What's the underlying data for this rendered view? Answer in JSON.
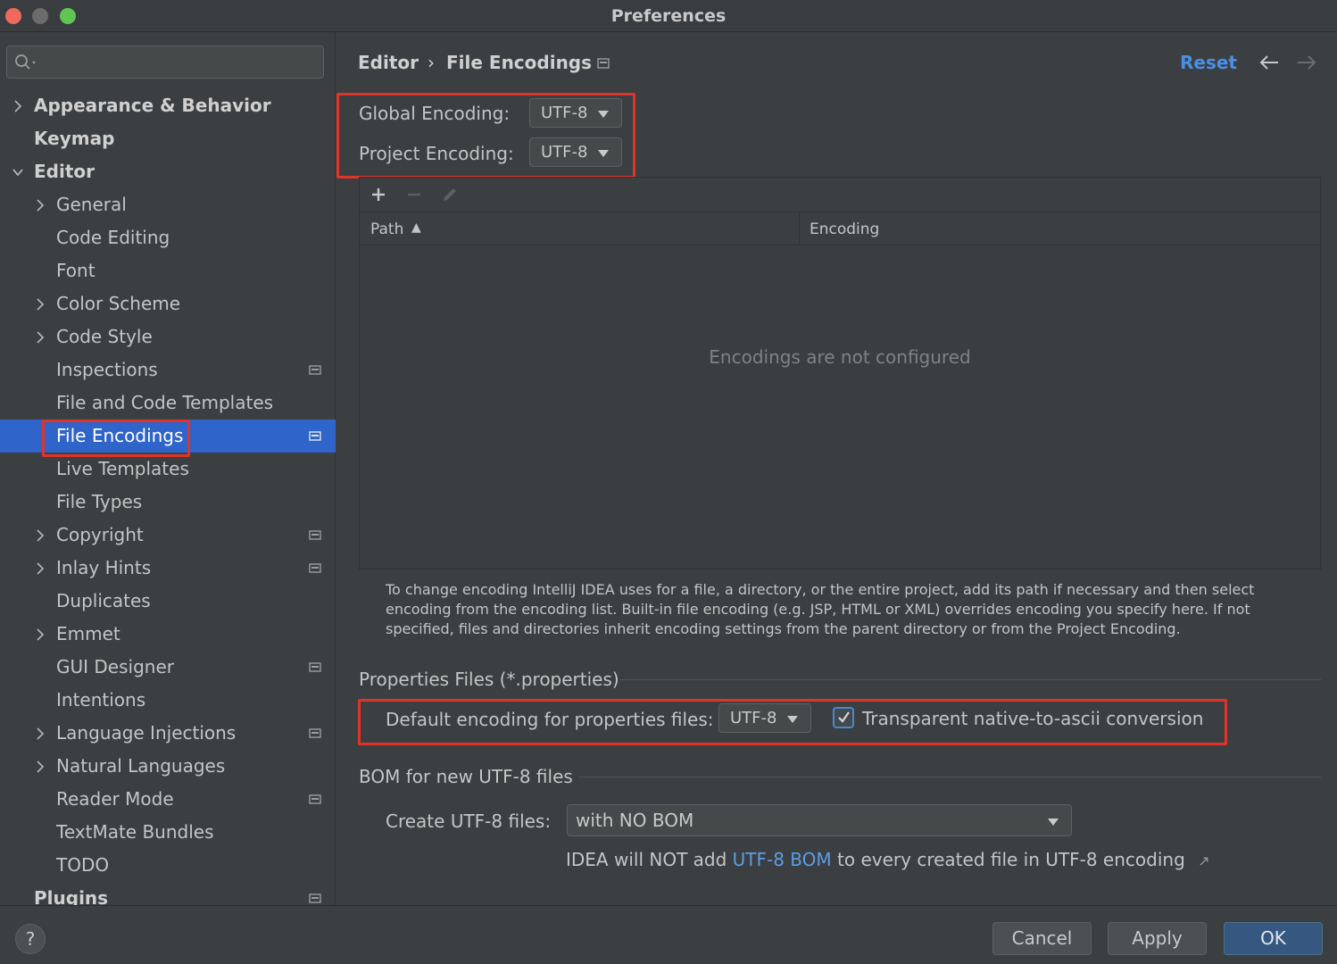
{
  "window": {
    "title": "Preferences"
  },
  "sidebar": {
    "search_placeholder": "",
    "items": [
      {
        "label": "Appearance & Behavior",
        "level": 0,
        "expandable": true,
        "expanded": false,
        "has_project_icon": false
      },
      {
        "label": "Keymap",
        "level": 0,
        "expandable": false,
        "has_project_icon": false
      },
      {
        "label": "Editor",
        "level": 0,
        "expandable": true,
        "expanded": true,
        "has_project_icon": false
      },
      {
        "label": "General",
        "level": 1,
        "expandable": true,
        "has_project_icon": false
      },
      {
        "label": "Code Editing",
        "level": 1,
        "expandable": false,
        "has_project_icon": false
      },
      {
        "label": "Font",
        "level": 1,
        "expandable": false,
        "has_project_icon": false
      },
      {
        "label": "Color Scheme",
        "level": 1,
        "expandable": true,
        "has_project_icon": false
      },
      {
        "label": "Code Style",
        "level": 1,
        "expandable": true,
        "has_project_icon": false
      },
      {
        "label": "Inspections",
        "level": 1,
        "expandable": false,
        "has_project_icon": true
      },
      {
        "label": "File and Code Templates",
        "level": 1,
        "expandable": false,
        "has_project_icon": false
      },
      {
        "label": "File Encodings",
        "level": 1,
        "expandable": false,
        "has_project_icon": true,
        "selected": true
      },
      {
        "label": "Live Templates",
        "level": 1,
        "expandable": false,
        "has_project_icon": false
      },
      {
        "label": "File Types",
        "level": 1,
        "expandable": false,
        "has_project_icon": false
      },
      {
        "label": "Copyright",
        "level": 1,
        "expandable": true,
        "has_project_icon": true
      },
      {
        "label": "Inlay Hints",
        "level": 1,
        "expandable": true,
        "has_project_icon": true
      },
      {
        "label": "Duplicates",
        "level": 1,
        "expandable": false,
        "has_project_icon": false
      },
      {
        "label": "Emmet",
        "level": 1,
        "expandable": true,
        "has_project_icon": false
      },
      {
        "label": "GUI Designer",
        "level": 1,
        "expandable": false,
        "has_project_icon": true
      },
      {
        "label": "Intentions",
        "level": 1,
        "expandable": false,
        "has_project_icon": false
      },
      {
        "label": "Language Injections",
        "level": 1,
        "expandable": true,
        "has_project_icon": true
      },
      {
        "label": "Natural Languages",
        "level": 1,
        "expandable": true,
        "has_project_icon": false
      },
      {
        "label": "Reader Mode",
        "level": 1,
        "expandable": false,
        "has_project_icon": true
      },
      {
        "label": "TextMate Bundles",
        "level": 1,
        "expandable": false,
        "has_project_icon": false
      },
      {
        "label": "TODO",
        "level": 1,
        "expandable": false,
        "has_project_icon": false
      },
      {
        "label": "Plugins",
        "level": 0,
        "expandable": false,
        "has_project_icon": true
      }
    ]
  },
  "header": {
    "breadcrumb": [
      "Editor",
      "File Encodings"
    ],
    "breadcrumb_separator": "›",
    "reset_label": "Reset"
  },
  "encodings": {
    "global_label": "Global Encoding:",
    "global_value": "UTF-8",
    "project_label": "Project Encoding:",
    "project_value": "UTF-8"
  },
  "table": {
    "columns": [
      "Path",
      "Encoding"
    ],
    "sort_indicator": "▲",
    "empty_text": "Encodings are not configured",
    "rows": []
  },
  "help_text": "To change encoding IntelliJ IDEA uses for a file, a directory, or the entire project, add its path if necessary and then select encoding from the encoding list. Built-in file encoding (e.g. JSP, HTML or XML) overrides encoding you specify here. If not specified, files and directories inherit encoding settings from the parent directory or from the Project Encoding.",
  "properties": {
    "section_title": "Properties Files (*.properties)",
    "default_label": "Default encoding for properties files:",
    "default_value": "UTF-8",
    "native_to_ascii_label": "Transparent native-to-ascii conversion",
    "native_to_ascii_checked": true
  },
  "bom": {
    "section_title": "BOM for new UTF-8 files",
    "create_label": "Create UTF-8 files:",
    "create_value": "with NO BOM",
    "note_prefix": "IDEA will NOT add ",
    "note_link": "UTF-8 BOM",
    "note_suffix": " to every created file in UTF-8 encoding",
    "note_arrow": "↗"
  },
  "footer": {
    "help_label": "?",
    "cancel_label": "Cancel",
    "apply_label": "Apply",
    "ok_label": "OK"
  },
  "colors": {
    "accent": "#2f65ca",
    "link": "#4a8fe6",
    "highlight_box": "#e0342a"
  }
}
